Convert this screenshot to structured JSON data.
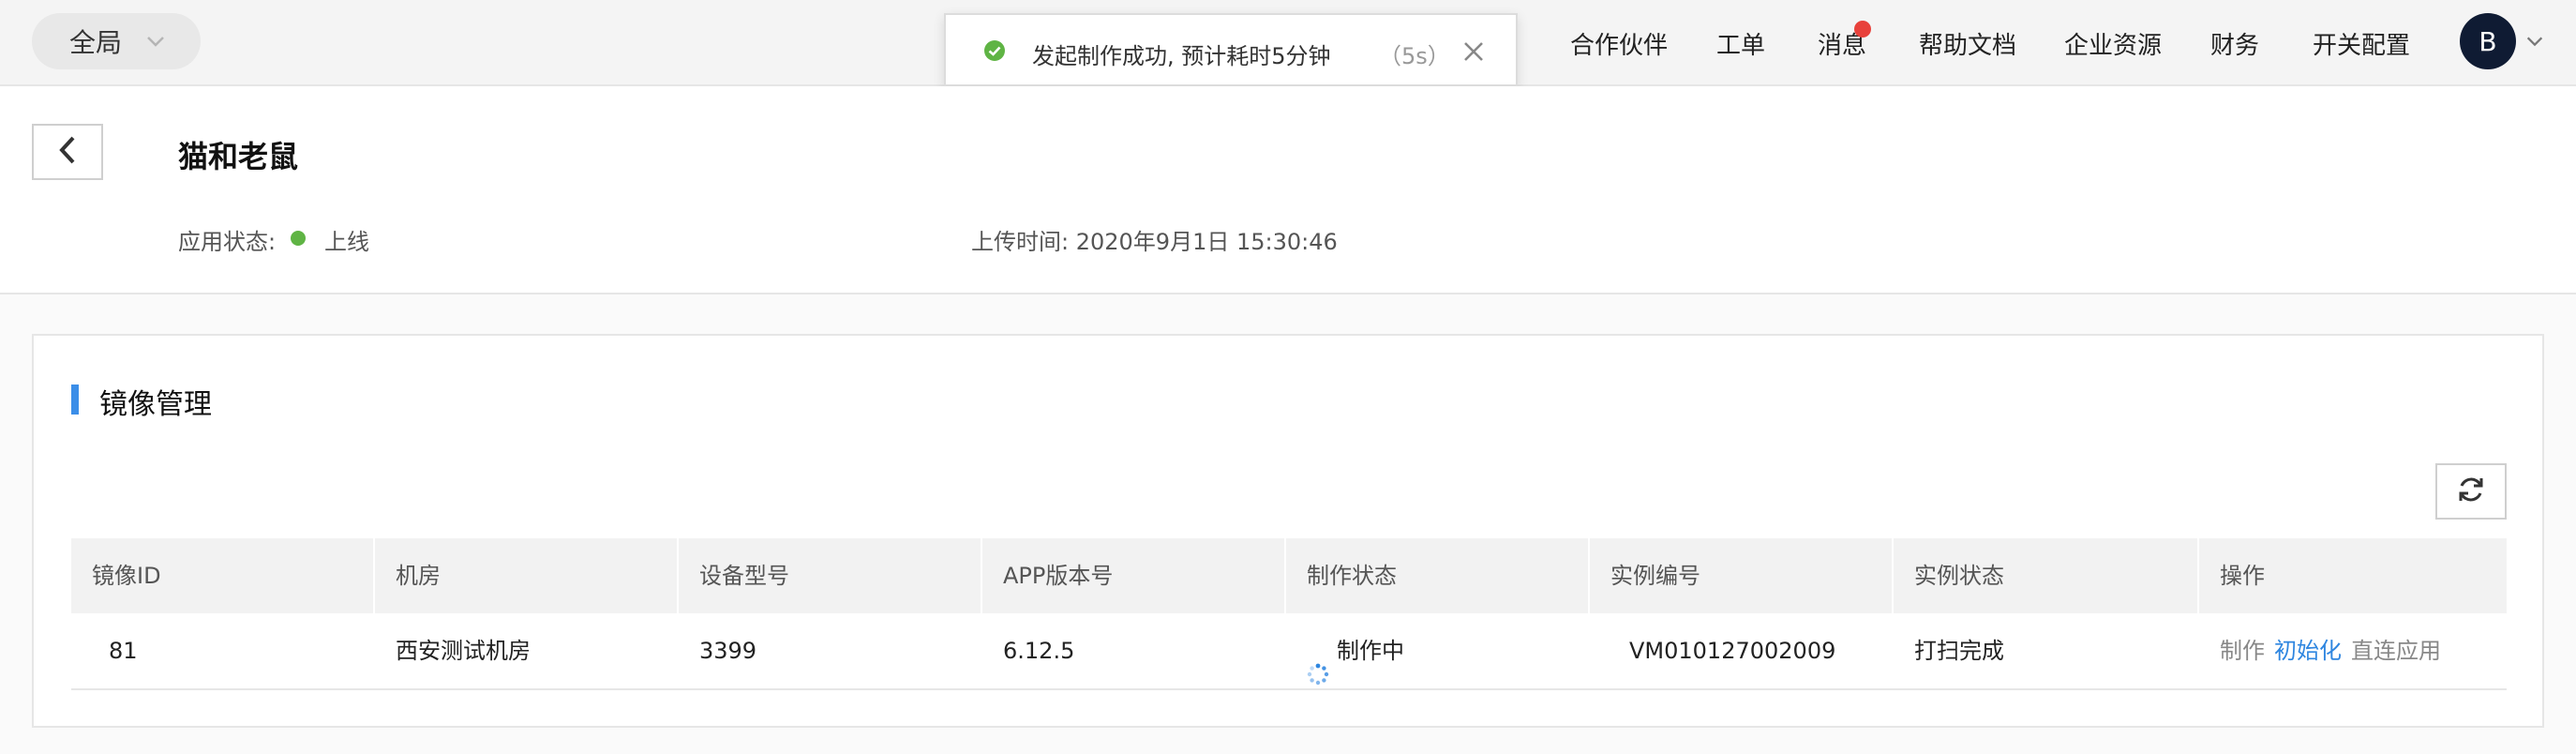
{
  "topbar": {
    "scope_label": "全局",
    "nav": [
      {
        "label": "合作伙伴"
      },
      {
        "label": "工单"
      },
      {
        "label": "消息",
        "has_badge": true
      },
      {
        "label": "帮助文档"
      },
      {
        "label": "企业资源"
      },
      {
        "label": "财务"
      },
      {
        "label": "开关配置"
      }
    ],
    "avatar_letter": "B"
  },
  "toast": {
    "message": "发起制作成功, 预计耗时5分钟",
    "countdown": "（5s）",
    "status_color": "#5fb444"
  },
  "header": {
    "app_name": "猫和老鼠",
    "status_label": "应用状态:",
    "status_value": "上线",
    "status_color": "#5fb444",
    "upload_label": "上传时间:",
    "upload_time": "2020年9月1日 15:30:46"
  },
  "section": {
    "title": "镜像管理",
    "accent": "#3b8ee8"
  },
  "table": {
    "columns": [
      "镜像ID",
      "机房",
      "设备型号",
      "APP版本号",
      "制作状态",
      "实例编号",
      "实例状态",
      "操作"
    ],
    "rows": [
      {
        "id": "81",
        "room": "西安测试机房",
        "device": "3399",
        "app_version": "6.12.5",
        "build_status": "制作中",
        "instance_no": "VM010127002009",
        "instance_status": "打扫完成",
        "actions": [
          "制作",
          "初始化",
          "直连应用"
        ]
      }
    ]
  }
}
